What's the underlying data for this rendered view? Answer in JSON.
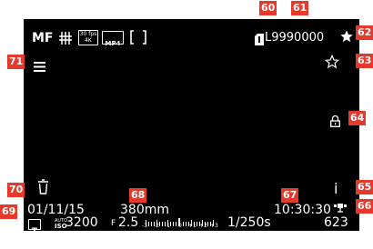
{
  "focus_mode": "MF",
  "video": {
    "fps_line1": "30 fps",
    "fps_line2": "4K",
    "format": "MP4"
  },
  "card_slot": "1",
  "remaining": "L9990000",
  "date": "01/11/15",
  "focal_length": "380mm",
  "time": "10:30:30",
  "info_symbol": "i",
  "iso_label_top": "AUTO",
  "iso_label_bottom": "ISO",
  "iso_value": "3200",
  "aperture_label": "F",
  "aperture_value": "2.5",
  "ev_scale": [
    "-3",
    "-2",
    "-1",
    "0",
    "+1",
    "+2",
    "+3"
  ],
  "shutter": "1/250s",
  "shots": "623",
  "exposure_mode": "T",
  "markers": {
    "m60": "60",
    "m61": "61",
    "m62": "62",
    "m63": "63",
    "m64": "64",
    "m65": "65",
    "m66": "66",
    "m67": "67",
    "m68": "68",
    "m69": "69",
    "m70": "70",
    "m71": "71"
  },
  "colors": {
    "screen": "#000000",
    "marker": "#e53a2b",
    "text": "#ffffff"
  },
  "icons": [
    "menu-icon",
    "star-filled-icon",
    "star-outline-icon",
    "lock-icon",
    "delete-icon",
    "gps-satellite-icon",
    "af-frame-icon",
    "grid-icon",
    "sd-card-icon"
  ]
}
